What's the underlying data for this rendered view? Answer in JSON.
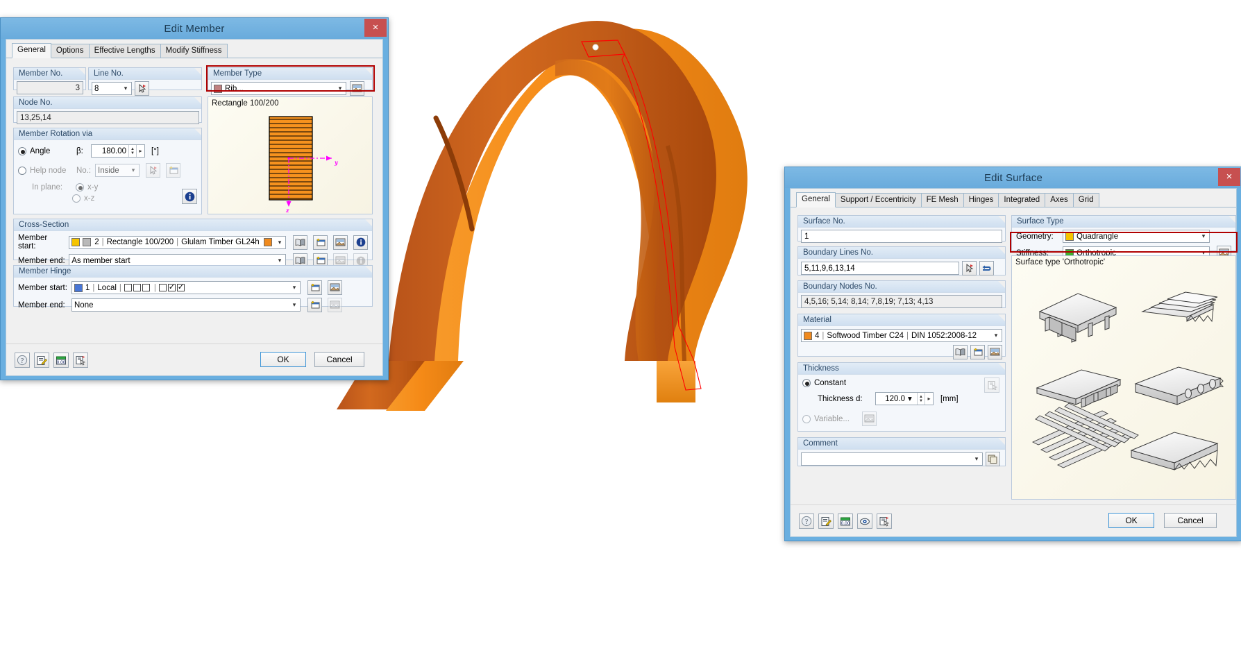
{
  "app": {
    "background_description": "3D rendering of an orange glulam timber arch shell structure",
    "model_colors": {
      "shell_light": "#F08A1E",
      "shell_mid": "#D2691E",
      "shell_dark": "#A8480C",
      "selection": "#FF0000"
    }
  },
  "member_dialog": {
    "title": "Edit Member",
    "close_label": "×",
    "tabs": [
      {
        "label": "General",
        "active": true
      },
      {
        "label": "Options",
        "active": false
      },
      {
        "label": "Effective Lengths",
        "active": false
      },
      {
        "label": "Modify Stiffness",
        "active": false
      }
    ],
    "member_no": {
      "caption": "Member No.",
      "value": "3"
    },
    "line_no": {
      "caption": "Line No.",
      "value": "8"
    },
    "member_type": {
      "caption": "Member Type",
      "value": "Rib...",
      "swatch": "#c08080",
      "highlighted": true
    },
    "node_no": {
      "caption": "Node No.",
      "value": "13,25,14"
    },
    "rotation": {
      "caption": "Member Rotation via",
      "angle_label": "Angle",
      "angle_selected": true,
      "beta_label": "β:",
      "beta_value": "180.00",
      "beta_unit": "[°]",
      "help_node_label": "Help node",
      "help_node_selected": false,
      "no_label": "No.:",
      "no_value": "Inside",
      "in_plane_label": "In plane:",
      "plane_xy": "x-y",
      "plane_xz": "x-z",
      "plane_selected": "x-y"
    },
    "preview": {
      "caption": "Rectangle 100/200",
      "axis_y": "y",
      "axis_z": "z"
    },
    "cross_section": {
      "caption": "Cross-Section",
      "start_label": "Member start:",
      "start_no": "2",
      "start_name": "Rectangle 100/200",
      "start_material": "Glulam Timber GL24h",
      "start_swatch": "#f5c400",
      "start_swatch2": "#b9b9b9",
      "start_color": "#F08A1E",
      "end_label": "Member end:",
      "end_value": "As member start"
    },
    "member_hinge": {
      "caption": "Member Hinge",
      "start_label": "Member start:",
      "start_no": "1",
      "start_system": "Local",
      "start_swatch": "#4876d6",
      "start_checks": [
        false,
        false,
        false,
        false,
        true,
        true
      ],
      "end_label": "Member end:",
      "end_value": "None"
    },
    "footer": {
      "help_icon": "help-icon",
      "comment_icon": "notes-icon",
      "units_icon": "units-icon",
      "render_icon": "render-icon",
      "ok_label": "OK",
      "cancel_label": "Cancel"
    }
  },
  "surface_dialog": {
    "title": "Edit Surface",
    "close_label": "×",
    "tabs": [
      {
        "label": "General",
        "active": true
      },
      {
        "label": "Support / Eccentricity",
        "active": false
      },
      {
        "label": "FE Mesh",
        "active": false
      },
      {
        "label": "Hinges",
        "active": false
      },
      {
        "label": "Integrated",
        "active": false
      },
      {
        "label": "Axes",
        "active": false
      },
      {
        "label": "Grid",
        "active": false
      }
    ],
    "surface_no": {
      "caption": "Surface No.",
      "value": "1"
    },
    "boundary_lines": {
      "caption": "Boundary Lines No.",
      "value": "5,11,9,6,13,14"
    },
    "boundary_nodes": {
      "caption": "Boundary Nodes No.",
      "value": "4,5,16; 5,14; 8,14; 7,8,19; 7,13; 4,13"
    },
    "material": {
      "caption": "Material",
      "no": "4",
      "name": "Softwood Timber C24",
      "standard": "DIN 1052:2008-12",
      "swatch": "#F08A1E"
    },
    "thickness": {
      "caption": "Thickness",
      "constant_label": "Constant",
      "constant_selected": true,
      "d_label": "Thickness d:",
      "d_value": "120.0",
      "d_unit": "[mm]",
      "variable_label": "Variable...",
      "variable_selected": false
    },
    "comment": {
      "caption": "Comment",
      "value": ""
    },
    "surface_type": {
      "caption": "Surface Type",
      "geometry_label": "Geometry:",
      "geometry_value": "Quadrangle",
      "geometry_swatch": "#f5c400",
      "stiffness_label": "Stiffness:",
      "stiffness_value": "Orthotropic",
      "stiffness_swatch": "#3db22b",
      "highlighted": true,
      "preview_caption": "Surface type 'Orthotropic'"
    },
    "footer": {
      "help_icon": "help-icon",
      "comment_icon": "notes-icon",
      "units_icon": "units-icon",
      "visibility_icon": "eye-icon",
      "render_icon": "render-icon",
      "ok_label": "OK",
      "cancel_label": "Cancel"
    }
  }
}
